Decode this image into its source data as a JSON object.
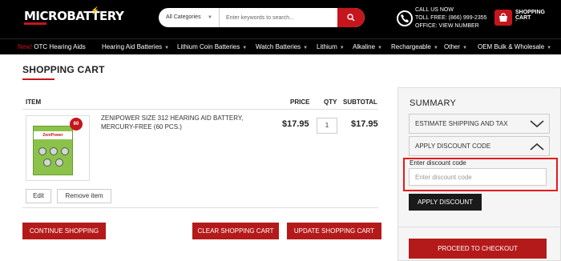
{
  "header": {
    "logo": "MICROBATTERY",
    "search": {
      "category": "All Categories",
      "placeholder": "Enter keywords to search..."
    },
    "contact": {
      "line1": "CALL US NOW",
      "line2": "TOLL FREE: (866) 999-2355",
      "line3": "OFFICE: VIEW NUMBER"
    },
    "cart": {
      "label": "SHOPPING CART",
      "count": "-"
    }
  },
  "nav": {
    "items": [
      {
        "label": "OTC Hearing Aids",
        "prefix": "New!"
      },
      {
        "label": "Hearing Aid Batteries"
      },
      {
        "label": "Lithium Coin Batteries"
      },
      {
        "label": "Watch Batteries"
      },
      {
        "label": "Lithium"
      },
      {
        "label": "Alkaline"
      },
      {
        "label": "Rechargeable"
      },
      {
        "label": "Other"
      },
      {
        "label": "OEM Bulk & Wholesale"
      }
    ]
  },
  "page": {
    "title": "SHOPPING CART"
  },
  "cart_table": {
    "headers": {
      "item": "ITEM",
      "price": "PRICE",
      "qty": "QTY",
      "subtotal": "SUBTOTAL"
    },
    "items": [
      {
        "name": "ZENIPOWER SIZE 312 HEARING AID BATTERY, MERCURY-FREE (60 PCS.)",
        "price": "$17.95",
        "qty": "1",
        "subtotal": "$17.95",
        "image": {
          "brand": "ZeniPower",
          "badge": "60"
        }
      }
    ],
    "edit_label": "Edit",
    "remove_label": "Remove item"
  },
  "actions": {
    "continue": "CONTINUE SHOPPING",
    "clear": "CLEAR SHOPPING CART",
    "update": "UPDATE SHOPPING CART"
  },
  "summary": {
    "title": "SUMMARY",
    "estimate_label": "ESTIMATE SHIPPING AND TAX",
    "discount_label": "APPLY DISCOUNT CODE",
    "discount_field_label": "Enter discount code",
    "discount_placeholder": "Enter discount code",
    "apply_label": "APPLY DISCOUNT",
    "checkout_label": "PROCEED TO CHECKOUT"
  },
  "colors": {
    "accent": "#b51a1a",
    "header_bg": "#000000",
    "highlight": "#e31b1b"
  }
}
